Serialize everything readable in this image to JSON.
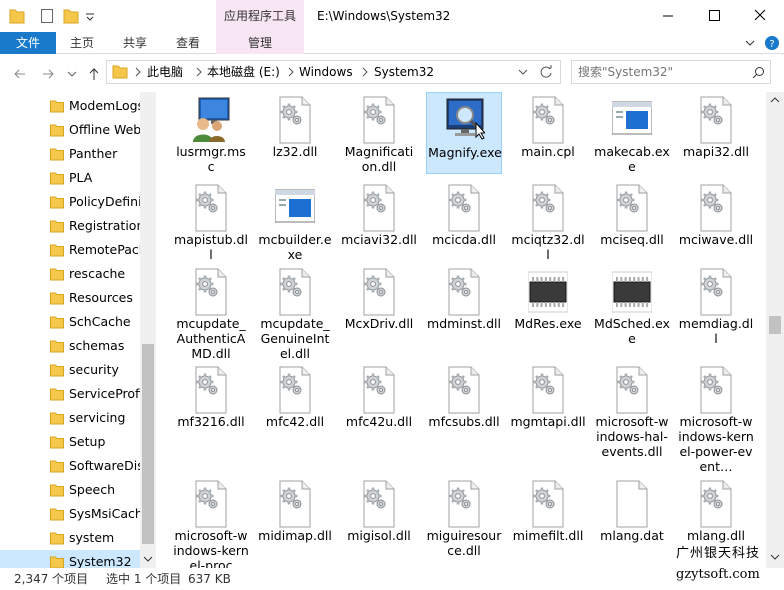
{
  "title_bar": {
    "context_tab": "应用程序工具",
    "path_title": "E:\\Windows\\System32"
  },
  "ribbon": {
    "file": "文件",
    "tabs": [
      "主页",
      "共享",
      "查看"
    ],
    "manage": "管理"
  },
  "address": {
    "crumbs": [
      "此电脑",
      "本地磁盘 (E:)",
      "Windows",
      "System32"
    ]
  },
  "search": {
    "placeholder": "搜索\"System32\""
  },
  "nav": {
    "items": [
      "ModemLogs",
      "Offline Web",
      "Panther",
      "PLA",
      "PolicyDefinit",
      "Registration",
      "RemotePack",
      "rescache",
      "Resources",
      "SchCache",
      "schemas",
      "security",
      "ServiceProfil",
      "servicing",
      "Setup",
      "SoftwareDist",
      "Speech",
      "SysMsiCache",
      "system",
      "System32"
    ],
    "selected": "System32"
  },
  "files": [
    {
      "name": "lusrmgr.msc",
      "icon": "users-monitor-icon"
    },
    {
      "name": "lz32.dll",
      "icon": "dll-gear-icon"
    },
    {
      "name": "Magnification.dll",
      "icon": "dll-gear-icon"
    },
    {
      "name": "Magnify.exe",
      "icon": "magnifier-monitor-icon",
      "selected": true
    },
    {
      "name": "main.cpl",
      "icon": "dll-gear-icon"
    },
    {
      "name": "makecab.exe",
      "icon": "exe-window-icon"
    },
    {
      "name": "mapi32.dll",
      "icon": "dll-gear-icon"
    },
    {
      "name": "mapistub.dll",
      "icon": "dll-gear-icon"
    },
    {
      "name": "mcbuilder.exe",
      "icon": "exe-window-icon"
    },
    {
      "name": "mciavi32.dll",
      "icon": "dll-gear-icon"
    },
    {
      "name": "mcicda.dll",
      "icon": "dll-gear-icon"
    },
    {
      "name": "mciqtz32.dll",
      "icon": "dll-gear-icon"
    },
    {
      "name": "mciseq.dll",
      "icon": "dll-gear-icon"
    },
    {
      "name": "mciwave.dll",
      "icon": "dll-gear-icon"
    },
    {
      "name": "mcupdate_AuthenticAMD.dll",
      "icon": "dll-gear-icon"
    },
    {
      "name": "mcupdate_GenuineIntel.dll",
      "icon": "dll-gear-icon"
    },
    {
      "name": "McxDriv.dll",
      "icon": "dll-gear-icon"
    },
    {
      "name": "mdminst.dll",
      "icon": "dll-gear-icon"
    },
    {
      "name": "MdRes.exe",
      "icon": "chip-icon"
    },
    {
      "name": "MdSched.exe",
      "icon": "chip-icon"
    },
    {
      "name": "memdiag.dll",
      "icon": "dll-gear-icon"
    },
    {
      "name": "mf3216.dll",
      "icon": "dll-gear-icon"
    },
    {
      "name": "mfc42.dll",
      "icon": "dll-gear-icon"
    },
    {
      "name": "mfc42u.dll",
      "icon": "dll-gear-icon"
    },
    {
      "name": "mfcsubs.dll",
      "icon": "dll-gear-icon"
    },
    {
      "name": "mgmtapi.dll",
      "icon": "dll-gear-icon"
    },
    {
      "name": "microsoft-windows-hal-events.dll",
      "icon": "dll-gear-icon"
    },
    {
      "name": "microsoft-windows-kernel-power-event…",
      "icon": "dll-gear-icon"
    },
    {
      "name": "microsoft-windows-kernel-proc",
      "icon": "dll-gear-icon"
    },
    {
      "name": "midimap.dll",
      "icon": "dll-gear-icon"
    },
    {
      "name": "migisol.dll",
      "icon": "dll-gear-icon"
    },
    {
      "name": "miguiresource.dll",
      "icon": "dll-gear-icon"
    },
    {
      "name": "mimefilt.dll",
      "icon": "dll-gear-icon"
    },
    {
      "name": "mlang.dat",
      "icon": "blank-file-icon"
    },
    {
      "name": "mlang.dll",
      "icon": "dll-gear-icon"
    }
  ],
  "status": {
    "count": "2,347 个项目",
    "selected": "选中 1 个项目",
    "size": "637 KB"
  },
  "watermark": {
    "line1": "广州银天科技",
    "line2": "gzytsoft.com"
  },
  "colors": {
    "file_tab": "#1979ca",
    "selection": "#cce8ff",
    "context_tab": "#f8e6f4"
  }
}
